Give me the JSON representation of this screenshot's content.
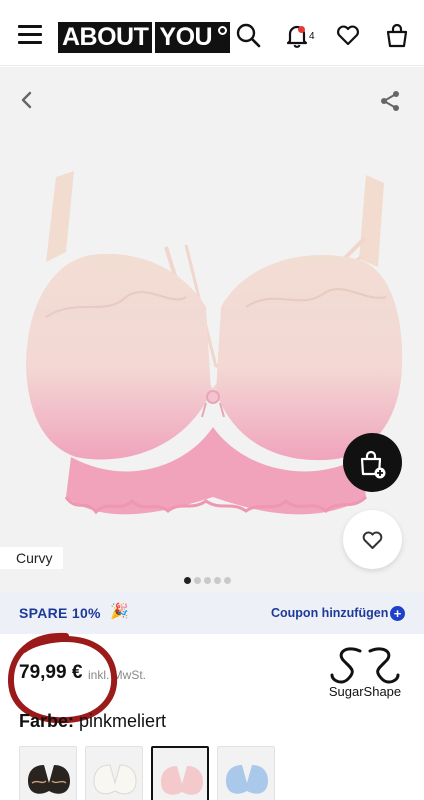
{
  "header": {
    "logo_left": "ABOUT",
    "logo_right": "YOU",
    "notification_count": "4"
  },
  "gallery": {
    "badge": "Curvy",
    "dots_total": 5,
    "dots_active": 1
  },
  "promo": {
    "spare_text": "SPARE 10%",
    "spare_emoji": "🎉",
    "coupon_label": "Coupon hinzufügen",
    "coupon_icon": "+"
  },
  "price": {
    "value": "79,99 €",
    "vat_note": "inkl. MwSt."
  },
  "brand": {
    "name": "SugarShape",
    "monogram": "SS"
  },
  "color": {
    "label": "Farbe:",
    "value": "pinkmeliert"
  },
  "swatches": [
    {
      "name": "black",
      "color": "#2a2420",
      "selected": false
    },
    {
      "name": "white",
      "color": "#f4f3ee",
      "selected": false
    },
    {
      "name": "pink",
      "color": "#f3c9cc",
      "selected": true
    },
    {
      "name": "blue",
      "color": "#a9c8ea",
      "selected": false
    }
  ],
  "colors": {
    "promo_text": "#1c3a99",
    "promo_bg": "#eef0f7",
    "annotation_circle": "#9b1a1a"
  }
}
